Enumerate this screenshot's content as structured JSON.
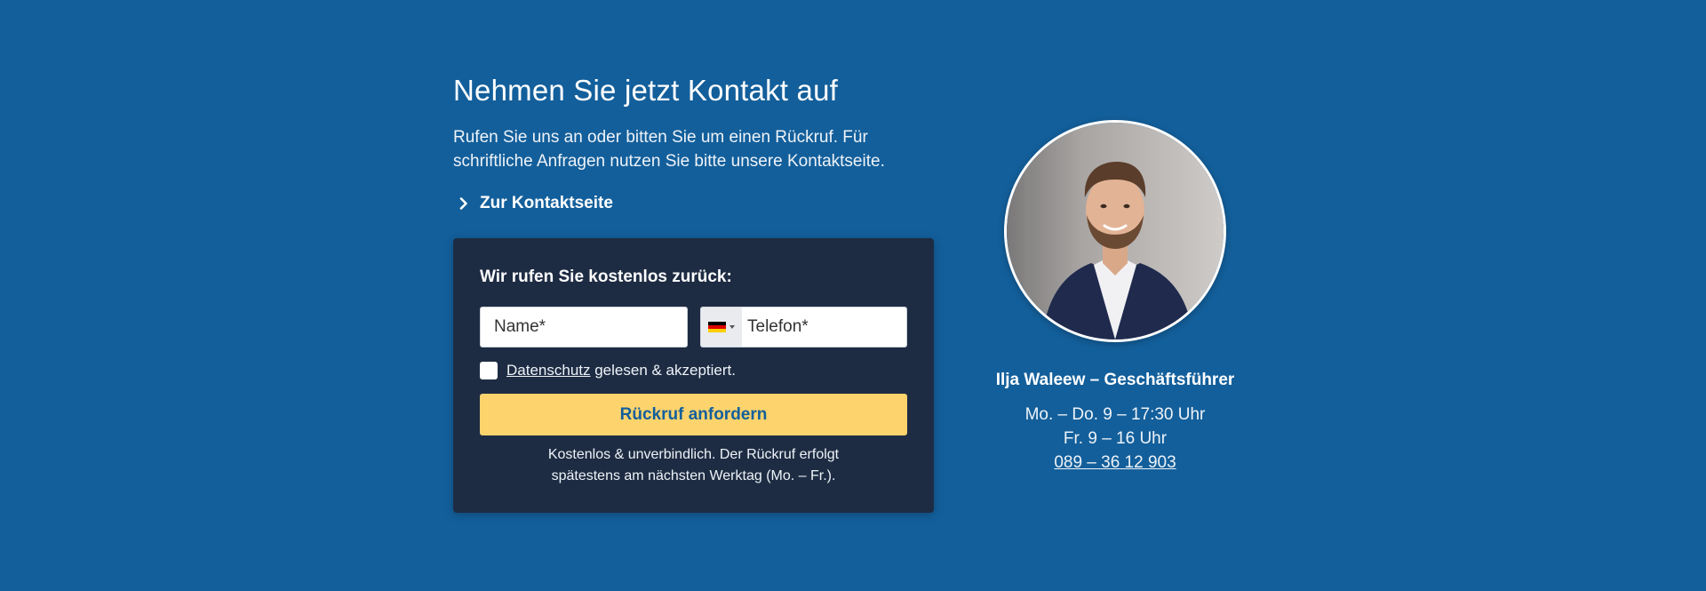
{
  "heading": "Nehmen Sie jetzt Kontakt auf",
  "intro": {
    "line1": "Rufen Sie uns an oder bitten Sie um einen Rückruf. Für",
    "line2": "schriftliche Anfragen nutzen Sie bitte unsere Kontaktseite."
  },
  "contact_link": {
    "label": "Zur Kontaktseite",
    "icon": "chevron-right-icon"
  },
  "callback_form": {
    "title": "Wir rufen Sie kostenlos zurück:",
    "name_placeholder": "Name*",
    "phone_placeholder": "Telefon*",
    "country_flag": "flag-de-icon",
    "consent_link": "Datenschutz",
    "consent_rest": " gelesen & akzeptiert.",
    "submit_label": "Rückruf anfordern",
    "note_line1": "Kostenlos & unverbindlich. Der Rückruf erfolgt",
    "note_line2": "spätestens am nächsten Werktag (Mo. – Fr.)."
  },
  "contact_person": {
    "name": "Ilja Waleew – Geschäftsführer",
    "hours_1": "Mo. – Do. 9 – 17:30 Uhr",
    "hours_2": "Fr. 9 – 16 Uhr",
    "phone": "089 – 36 12 903"
  },
  "colors": {
    "background": "#135f9b",
    "card": "#1e2c43",
    "button": "#fcd36d",
    "button_text": "#135f9b"
  }
}
